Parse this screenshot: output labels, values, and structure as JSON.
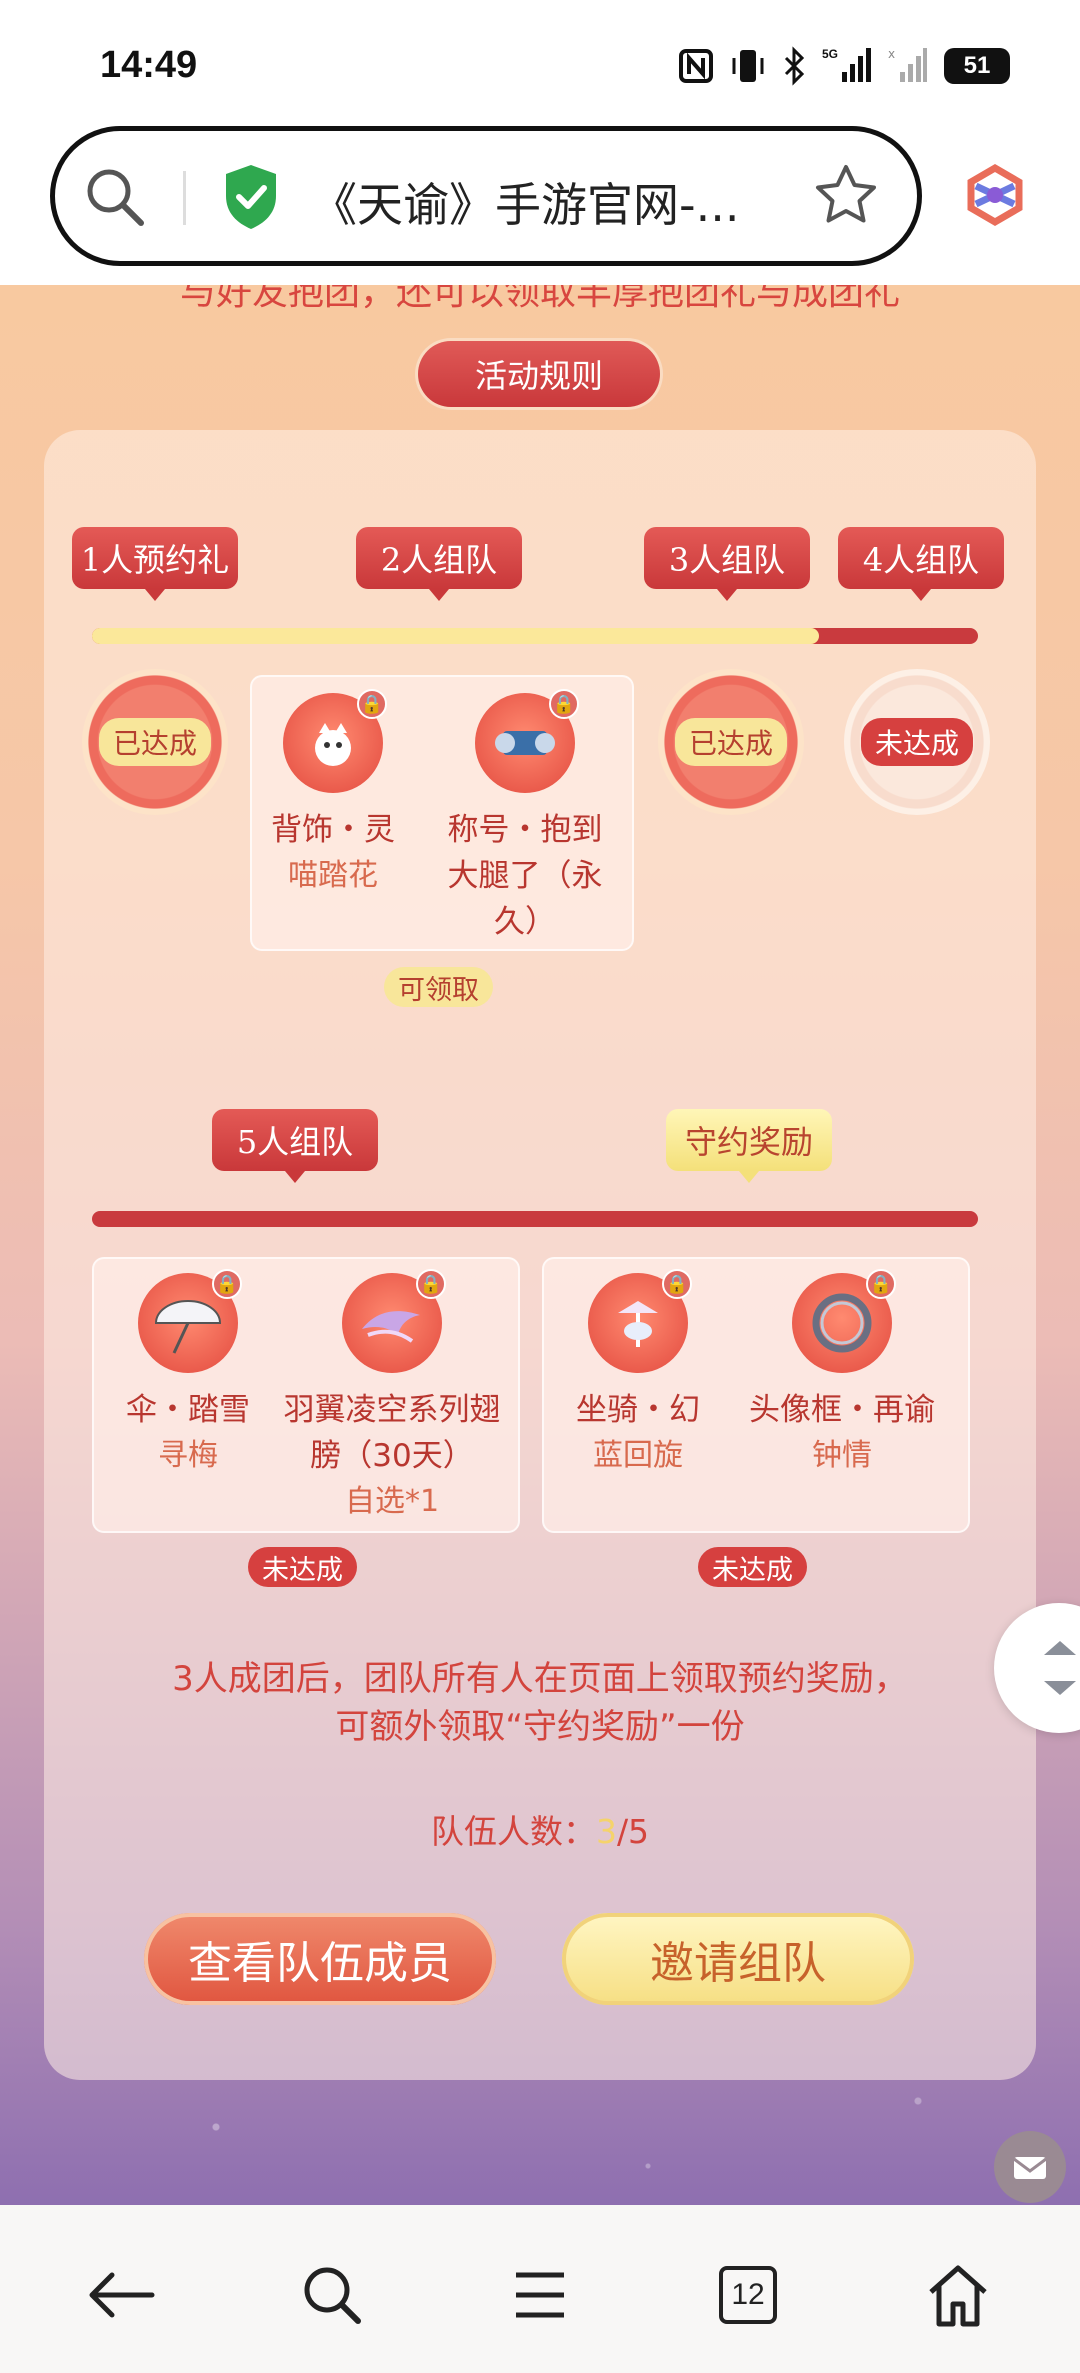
{
  "status": {
    "time": "14:49",
    "battery": "51",
    "signal_label": "5G"
  },
  "browser": {
    "title": "《天谕》手游官网-..."
  },
  "page": {
    "intro": "与好友抱团，还可以领取丰厚抱团礼与成团礼",
    "rules_button": "活动规则",
    "tiers_top": [
      "1人预约礼",
      "2人组队",
      "3人组队",
      "4人组队"
    ],
    "progress_top": 0.82,
    "tier1_status": "已达成",
    "tier3_status": "已达成",
    "tier4_status": "未达成",
    "tier2_rewards": [
      {
        "name": "背饰・灵",
        "sub": "喵踏花"
      },
      {
        "name": "称号・抱到大腿了（永久）",
        "sub": ""
      }
    ],
    "tier2_status": "可领取",
    "tiers_bottom": [
      "5人组队",
      "守约奖励"
    ],
    "progress_bottom": 0,
    "tier5_rewards": [
      {
        "name": "伞・踏雪",
        "sub": "寻梅"
      },
      {
        "name": "羽翼凌空系列翅膀（30天）",
        "sub": "自选*1"
      }
    ],
    "tier5_status": "未达成",
    "promise_rewards": [
      {
        "name": "坐骑・幻",
        "sub": "蓝回旋"
      },
      {
        "name": "头像框・再谕",
        "sub": "钟情"
      }
    ],
    "promise_status": "未达成",
    "note_line1": "3人成团后，团队所有人在页面上领取预约奖励，",
    "note_line2": "可额外领取“守约奖励”一份",
    "team_count_label": "队伍人数：",
    "team_count_current": "3",
    "team_count_total": "/5",
    "view_members_button": "查看队伍成员",
    "invite_button": "邀请组队"
  },
  "nav": {
    "tabs_count": "12"
  },
  "colors": {
    "accent_red": "#c93a3e",
    "gold": "#f8e69a"
  }
}
